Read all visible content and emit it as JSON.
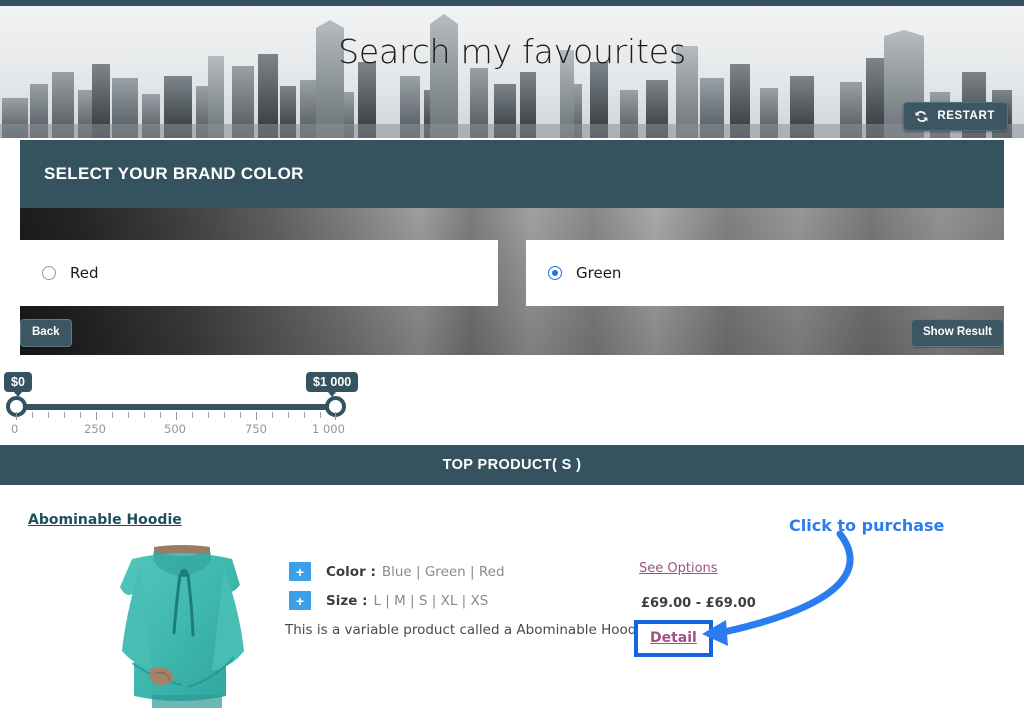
{
  "header": {
    "title": "Search my favourites",
    "restart_label": "RESTART",
    "restart_icon": "refresh-icon",
    "accent_color": "#35535f"
  },
  "quiz": {
    "question": "SELECT YOUR BRAND COLOR",
    "options": [
      {
        "label": "Red",
        "selected": false
      },
      {
        "label": "Green",
        "selected": true
      }
    ],
    "back_label": "Back",
    "show_result_label": "Show Result",
    "selected_radio_color": "#1a73e8"
  },
  "price_slider": {
    "min_tooltip": "$0",
    "max_tooltip": "$1 000",
    "scale_labels": [
      "0",
      "250",
      "500",
      "750",
      "1 000"
    ],
    "min_value": 0,
    "max_value": 1000
  },
  "results": {
    "section_title": "TOP PRODUCT( S )",
    "product": {
      "name": "Abominable Hoodie",
      "image_alt": "teal-hoodie-photo",
      "attributes": [
        {
          "expand_icon": "plus-icon",
          "name": "Color :",
          "values": "Blue | Green | Red"
        },
        {
          "expand_icon": "plus-icon",
          "name": "Size :",
          "values": "L | M | S | XL | XS"
        }
      ],
      "description": "This is a variable product called a Abominable Hoodie",
      "see_options_label": "See Options",
      "price": "£69.00 - £69.00",
      "detail_label": "Detail"
    }
  },
  "annotation": {
    "text": "Click to purchase",
    "color": "#2b7cf0"
  }
}
